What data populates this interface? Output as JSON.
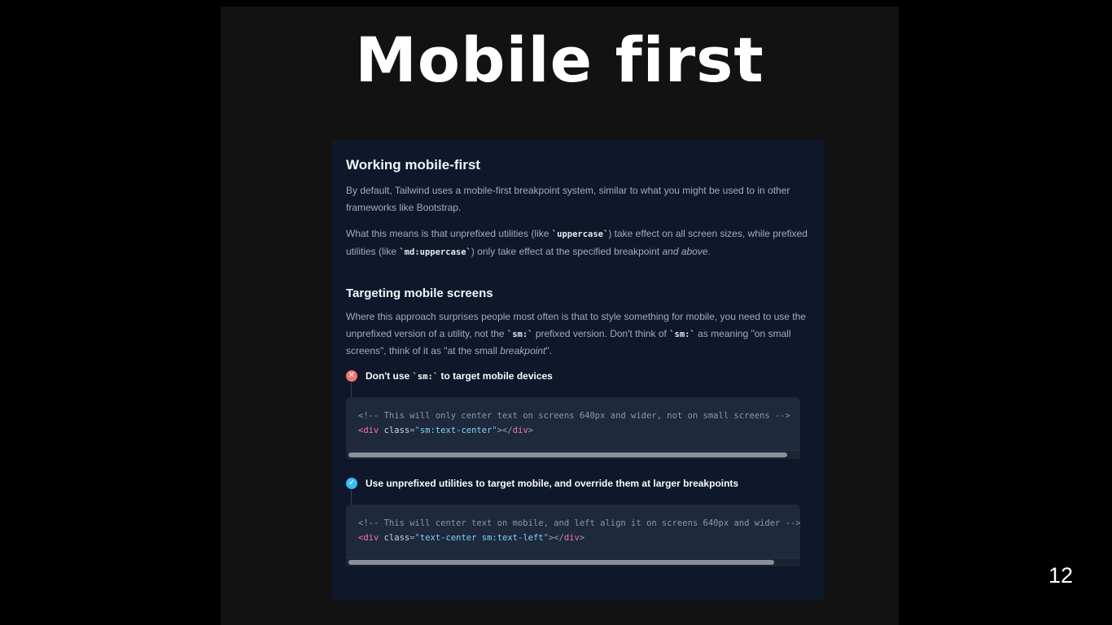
{
  "slide": {
    "title": "Mobile first",
    "page_number": "12"
  },
  "doc": {
    "heading1": "Working mobile-first",
    "p1": "By default, Tailwind uses a mobile-first breakpoint system, similar to what you might be used to in other frameworks like Bootstrap.",
    "p2": {
      "a": "What this means is that unprefixed utilities (like ",
      "code1": "`uppercase`",
      "b": ") take effect on all screen sizes, while prefixed utilities (like ",
      "code2": "`md:uppercase`",
      "c": ") only take effect at the specified breakpoint ",
      "em": "and above",
      "d": "."
    },
    "heading2": "Targeting mobile screens",
    "p3": {
      "a": "Where this approach surprises people most often is that to style something for mobile, you need to use the unprefixed version of a utility, not the ",
      "code1": "`sm:`",
      "b": " prefixed version. Don't think of ",
      "code2": "`sm:`",
      "c": " as meaning \"on small screens\", think of it as \"at the small ",
      "em": "breakpoint",
      "d": "\"."
    },
    "bad": {
      "icon": "x-icon",
      "color": "#f87171",
      "label_a": "Don't use ",
      "label_code": "`sm:`",
      "label_b": " to target mobile devices",
      "comment": "<!-- This will only center text on screens 640px and wider, not on small screens -->",
      "tag_open": "<div",
      "attr": "class",
      "eq": "=\"",
      "value": "sm:text-center",
      "close": "\"></",
      "tag_close": "div",
      "end": ">",
      "scroll_fraction": 0.98
    },
    "good": {
      "icon": "check-icon",
      "color": "#38bdf8",
      "label": "Use unprefixed utilities to target mobile, and override them at larger breakpoints",
      "comment": "<!-- This will center text on mobile, and left align it on screens 640px and wider -->",
      "tag_open": "<div",
      "attr": "class",
      "eq": "=\"",
      "value": "text-center sm:text-left",
      "close": "\"></",
      "tag_close": "div",
      "end": ">",
      "scroll_fraction": 0.95
    }
  }
}
